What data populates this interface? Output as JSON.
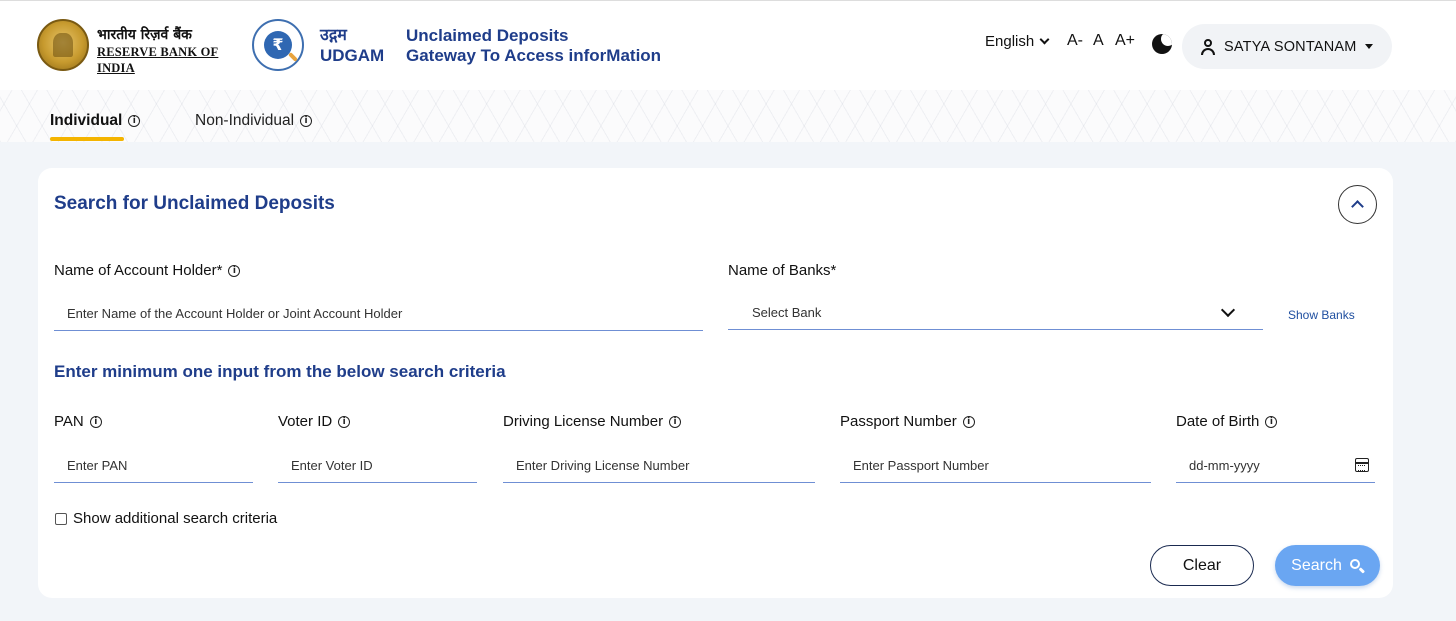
{
  "header": {
    "rbi_hindi": "भारतीय रिज़र्व बैंक",
    "rbi_english": "RESERVE BANK OF INDIA",
    "udgam_hindi": "उद्गम",
    "udgam_english": "UDGAM",
    "tagline_line1": "Unclaimed Deposits",
    "tagline_line2": "Gateway To Access inforMation",
    "language": "English",
    "font_decrease": "A-",
    "font_normal": "A",
    "font_increase": "A+",
    "user_name": "SATYA SONTANAM"
  },
  "tabs": [
    {
      "label": "Individual",
      "active": true
    },
    {
      "label": "Non-Individual",
      "active": false
    }
  ],
  "search_card": {
    "title": "Search for Unclaimed Deposits",
    "account_holder_label": "Name of Account Holder*",
    "account_holder_placeholder": "Enter Name of the Account Holder or Joint Account Holder",
    "banks_label": "Name of Banks*",
    "banks_value": "Select Bank",
    "show_banks": "Show Banks",
    "criteria_heading": "Enter minimum one input from the below search criteria",
    "pan_label": "PAN",
    "pan_placeholder": "Enter PAN",
    "voter_label": "Voter ID",
    "voter_placeholder": "Enter Voter ID",
    "dl_label": "Driving License Number",
    "dl_placeholder": "Enter Driving License Number",
    "passport_label": "Passport Number",
    "passport_placeholder": "Enter Passport Number",
    "dob_label": "Date of Birth",
    "dob_placeholder": "dd-mm-yyyy",
    "additional_criteria": "Show additional search criteria",
    "clear_label": "Clear",
    "search_label": "Search"
  },
  "colors": {
    "primary": "#1f3d8a",
    "accent_underline": "#f4b400",
    "search_button": "#6aa6f2",
    "field_border": "#6f8fd4"
  },
  "icons": [
    "rbi-seal-icon",
    "udgam-logo-icon",
    "chevron-down-icon",
    "theme-toggle-icon",
    "user-icon",
    "info-icon",
    "chevron-up-icon",
    "calendar-icon",
    "search-icon"
  ]
}
